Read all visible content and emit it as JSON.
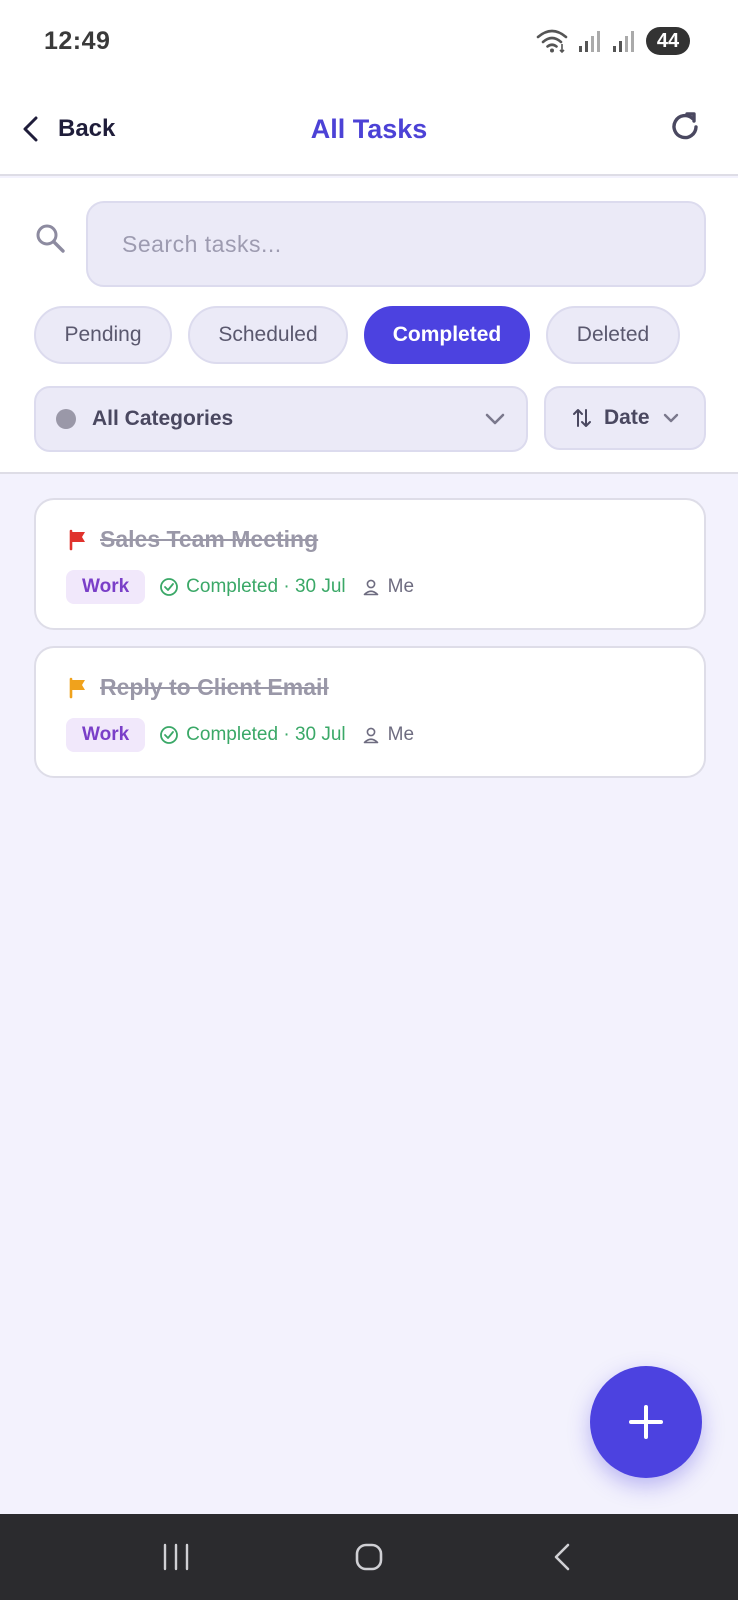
{
  "status_bar": {
    "time": "12:49",
    "battery": "44"
  },
  "header": {
    "back_label": "Back",
    "title": "All Tasks"
  },
  "search": {
    "placeholder": "Search tasks..."
  },
  "tabs": [
    {
      "label": "Pending",
      "active": false
    },
    {
      "label": "Scheduled",
      "active": false
    },
    {
      "label": "Completed",
      "active": true
    },
    {
      "label": "Deleted",
      "active": false
    }
  ],
  "filters": {
    "category_label": "All Categories",
    "sort_label": "Date"
  },
  "tasks": [
    {
      "title": "Sales Team Meeting",
      "flag_color": "#e0322c",
      "category": "Work",
      "status": "Completed · 30 Jul",
      "assignee": "Me"
    },
    {
      "title": "Reply to Client Email",
      "flag_color": "#f0a21c",
      "category": "Work",
      "status": "Completed · 30 Jul",
      "assignee": "Me"
    }
  ],
  "colors": {
    "accent": "#4c42e0",
    "completed": "#3aa867",
    "category_badge": "#7a3fc8"
  }
}
